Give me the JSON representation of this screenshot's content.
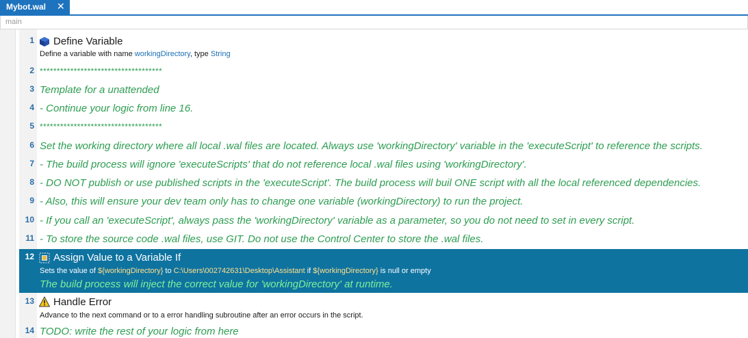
{
  "tab": {
    "title": "Mybot.wal",
    "close_icon": "close-icon"
  },
  "breadcrumb": {
    "label": "main"
  },
  "colors": {
    "accent": "#1e73be",
    "selected_row": "#0f73a0",
    "comment": "#2e9d52",
    "variable": "#1a6eb5",
    "line_number": "#2a6fa8"
  },
  "lines": {
    "l1": {
      "num": "1",
      "icon": "cube-icon",
      "title": "Define Variable",
      "desc_prefix": "Define a variable with name ",
      "desc_var": "workingDirectory",
      "desc_mid": ", type ",
      "desc_type": "String"
    },
    "l2": {
      "num": "2",
      "text": "************************************"
    },
    "l3": {
      "num": "3",
      "text": "Template for a unattended"
    },
    "l4": {
      "num": "4",
      "text": "- Continue your logic from line 16."
    },
    "l5": {
      "num": "5",
      "text": "************************************"
    },
    "l6": {
      "num": "6",
      "text": "Set the working directory where all local .wal files are located. Always use 'workingDirectory' variable in the 'executeScript' to reference the scripts."
    },
    "l7": {
      "num": "7",
      "text": "- The build process will ignore 'executeScripts' that do not reference local .wal files using 'workingDirectory'."
    },
    "l8": {
      "num": "8",
      "text": "- DO NOT publish or use published scripts in the 'executeScript'. The build process will buil ONE script with all the local referenced dependencies."
    },
    "l9": {
      "num": "9",
      "text": "- Also, this will ensure your dev team only has to change one variable (workingDirectory) to run the project."
    },
    "l10": {
      "num": "10",
      "text": "- If you call an 'executeScript', always pass the 'workingDirectory' variable as a parameter, so you do not need to set in every script."
    },
    "l11": {
      "num": "11",
      "text": "- To store the source code .wal files, use GIT. Do not use the Control Center to store the .wal files."
    },
    "l12": {
      "num": "12",
      "icon": "assign-variable-icon",
      "title": "Assign Value to a Variable If",
      "desc_prefix": "Sets the value of ",
      "desc_var1": "${workingDirectory}",
      "desc_to": " to ",
      "desc_value": "C:\\Users\\002742631\\Desktop\\Assistant",
      "desc_if": " if ",
      "desc_var2": "${workingDirectory}",
      "desc_suffix": " is null or empty",
      "comment": "The build process will inject the correct value for 'workingDirectory' at runtime."
    },
    "l13": {
      "num": "13",
      "icon": "warning-icon",
      "title": "Handle Error",
      "desc": "Advance to the next command or to a error handling subroutine after an error occurs in the script."
    },
    "l14": {
      "num": "14",
      "text": "TODO: write the rest of your logic from here"
    }
  }
}
